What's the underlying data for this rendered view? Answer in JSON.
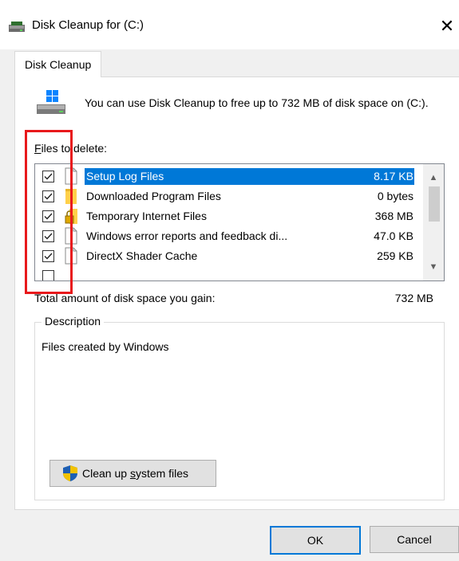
{
  "window": {
    "title": "Disk Cleanup for  (C:)",
    "close_icon": "close-icon"
  },
  "tab": {
    "label": "Disk Cleanup"
  },
  "intro": {
    "text": "You can use Disk Cleanup to free up to 732 MB of disk space on  (C:)."
  },
  "files": {
    "label_prefix": "F",
    "label_rest": "iles to delete:",
    "items": [
      {
        "name": "Setup Log Files",
        "size": "8.17 KB",
        "checked": true,
        "selected": true,
        "icon": "file-icon"
      },
      {
        "name": "Downloaded Program Files",
        "size": "0 bytes",
        "checked": true,
        "selected": false,
        "icon": "folder-icon"
      },
      {
        "name": "Temporary Internet Files",
        "size": "368 MB",
        "checked": true,
        "selected": false,
        "icon": "lock-icon"
      },
      {
        "name": "Windows error reports and feedback di...",
        "size": "47.0 KB",
        "checked": true,
        "selected": false,
        "icon": "file-icon"
      },
      {
        "name": "DirectX Shader Cache",
        "size": "259 KB",
        "checked": true,
        "selected": false,
        "icon": "file-icon"
      }
    ]
  },
  "total": {
    "label": "Total amount of disk space you gain:",
    "value": "732 MB"
  },
  "description": {
    "title": "Description",
    "text": "Files created by Windows"
  },
  "buttons": {
    "cleanup_system_prefix": "Clean up ",
    "cleanup_system_underlined": "s",
    "cleanup_system_rest": "ystem files",
    "ok": "OK",
    "cancel": "Cancel"
  },
  "colors": {
    "selection": "#0078d7",
    "highlight_box": "#e8191c"
  }
}
